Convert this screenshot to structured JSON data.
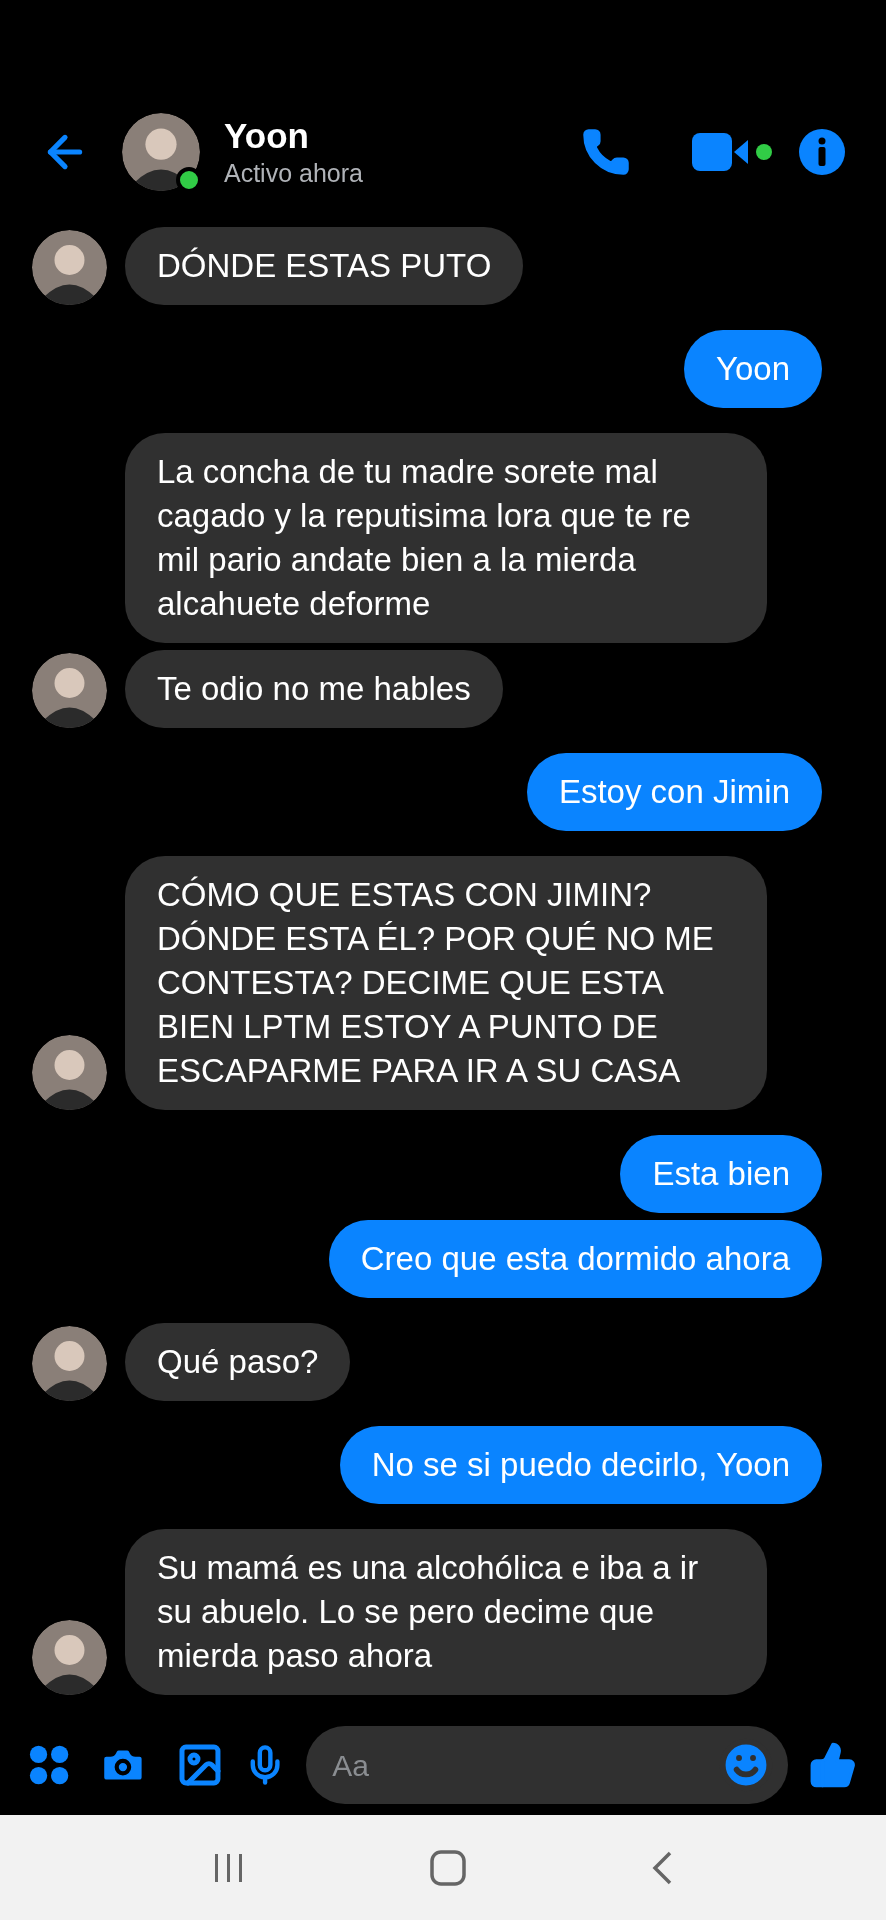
{
  "header": {
    "name": "Yoon",
    "status": "Activo ahora",
    "online": true
  },
  "messages": [
    {
      "kind": "them",
      "text": "DÓNDE ESTAS PUTO",
      "avatar": true
    },
    {
      "kind": "me",
      "text": "Yoon",
      "avatar": false
    },
    {
      "kind": "them",
      "text": "La concha de tu madre sorete mal cagado y la reputisima lora que te re mil pario andate bien a la mierda alcahuete deforme",
      "avatar": false
    },
    {
      "kind": "them",
      "text": "Te odio no me hables",
      "avatar": true
    },
    {
      "kind": "me",
      "text": "Estoy con Jimin",
      "avatar": false
    },
    {
      "kind": "them",
      "text": "CÓMO QUE ESTAS CON JIMIN? DÓNDE ESTA ÉL? POR QUÉ NO ME CONTESTA? DECIME QUE ESTA BIEN LPTM ESTOY A PUNTO DE ESCAPARME PARA IR A SU CASA",
      "avatar": true
    },
    {
      "kind": "me",
      "text": "Esta bien",
      "avatar": false
    },
    {
      "kind": "me",
      "text": "Creo que esta dormido ahora",
      "avatar": false
    },
    {
      "kind": "them",
      "text": "Qué paso?",
      "avatar": true
    },
    {
      "kind": "me",
      "text": "No se si puedo decirlo, Yoon",
      "avatar": false
    },
    {
      "kind": "them",
      "text": "Su mamá es una alcohólica e iba a ir su abuelo. Lo se pero decime que mierda paso ahora",
      "avatar": true
    }
  ],
  "composer": {
    "placeholder": "Aa"
  }
}
